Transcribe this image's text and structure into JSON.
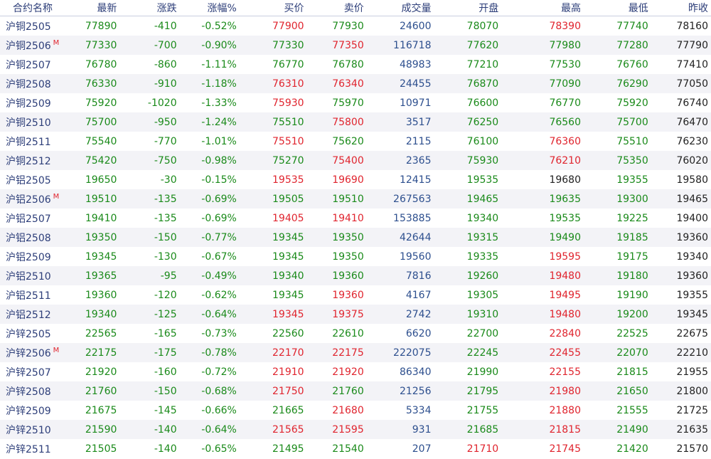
{
  "columns": [
    "合约名称",
    "最新",
    "涨跌",
    "涨幅%",
    "买价",
    "卖价",
    "成交量",
    "开盘",
    "最高",
    "最低",
    "昨收"
  ],
  "colors": {
    "green": "#1a8a1a",
    "red": "#e0242e",
    "black": "#222222",
    "blue": "#2d4f8e",
    "header": "#2d3e79",
    "stripe": "#f3f3f7"
  },
  "rows": [
    {
      "name": "沪铜2505",
      "badge": "",
      "last": "77890",
      "chg": "-410",
      "pct": "-0.52%",
      "bid": "77900",
      "ask": "77930",
      "vol": "24600",
      "open": "78070",
      "high": "78390",
      "low": "77740",
      "prev": "78160",
      "bid_c": "red",
      "ask_c": "green",
      "open_c": "green",
      "high_c": "red"
    },
    {
      "name": "沪铜2506",
      "badge": "M",
      "last": "77330",
      "chg": "-700",
      "pct": "-0.90%",
      "bid": "77330",
      "ask": "77350",
      "vol": "116718",
      "open": "77620",
      "high": "77980",
      "low": "77280",
      "prev": "77790",
      "bid_c": "green",
      "ask_c": "red",
      "open_c": "green",
      "high_c": "green"
    },
    {
      "name": "沪铜2507",
      "badge": "",
      "last": "76780",
      "chg": "-860",
      "pct": "-1.11%",
      "bid": "76770",
      "ask": "76780",
      "vol": "48983",
      "open": "77210",
      "high": "77530",
      "low": "76760",
      "prev": "77410",
      "bid_c": "green",
      "ask_c": "green",
      "open_c": "green",
      "high_c": "green"
    },
    {
      "name": "沪铜2508",
      "badge": "",
      "last": "76330",
      "chg": "-910",
      "pct": "-1.18%",
      "bid": "76310",
      "ask": "76340",
      "vol": "24455",
      "open": "76870",
      "high": "77090",
      "low": "76290",
      "prev": "77050",
      "bid_c": "red",
      "ask_c": "red",
      "open_c": "green",
      "high_c": "green"
    },
    {
      "name": "沪铜2509",
      "badge": "",
      "last": "75920",
      "chg": "-1020",
      "pct": "-1.33%",
      "bid": "75930",
      "ask": "75970",
      "vol": "10971",
      "open": "76600",
      "high": "76770",
      "low": "75920",
      "prev": "76740",
      "bid_c": "red",
      "ask_c": "green",
      "open_c": "green",
      "high_c": "green"
    },
    {
      "name": "沪铜2510",
      "badge": "",
      "last": "75700",
      "chg": "-950",
      "pct": "-1.24%",
      "bid": "75510",
      "ask": "75800",
      "vol": "3517",
      "open": "76250",
      "high": "76560",
      "low": "75700",
      "prev": "76470",
      "bid_c": "green",
      "ask_c": "red",
      "open_c": "green",
      "high_c": "green"
    },
    {
      "name": "沪铜2511",
      "badge": "",
      "last": "75540",
      "chg": "-770",
      "pct": "-1.01%",
      "bid": "75510",
      "ask": "75620",
      "vol": "2115",
      "open": "76100",
      "high": "76360",
      "low": "75510",
      "prev": "76230",
      "bid_c": "red",
      "ask_c": "green",
      "open_c": "green",
      "high_c": "red"
    },
    {
      "name": "沪铜2512",
      "badge": "",
      "last": "75420",
      "chg": "-750",
      "pct": "-0.98%",
      "bid": "75270",
      "ask": "75400",
      "vol": "2365",
      "open": "75930",
      "high": "76210",
      "low": "75350",
      "prev": "76020",
      "bid_c": "green",
      "ask_c": "red",
      "open_c": "green",
      "high_c": "red"
    },
    {
      "name": "沪铝2505",
      "badge": "",
      "last": "19650",
      "chg": "-30",
      "pct": "-0.15%",
      "bid": "19535",
      "ask": "19690",
      "vol": "12415",
      "open": "19535",
      "high": "19680",
      "low": "19355",
      "prev": "19580",
      "bid_c": "red",
      "ask_c": "red",
      "open_c": "green",
      "high_c": "black"
    },
    {
      "name": "沪铝2506",
      "badge": "M",
      "last": "19510",
      "chg": "-135",
      "pct": "-0.69%",
      "bid": "19505",
      "ask": "19510",
      "vol": "267563",
      "open": "19465",
      "high": "19635",
      "low": "19300",
      "prev": "19465",
      "bid_c": "green",
      "ask_c": "green",
      "open_c": "green",
      "high_c": "green"
    },
    {
      "name": "沪铝2507",
      "badge": "",
      "last": "19410",
      "chg": "-135",
      "pct": "-0.69%",
      "bid": "19405",
      "ask": "19410",
      "vol": "153885",
      "open": "19340",
      "high": "19535",
      "low": "19225",
      "prev": "19400",
      "bid_c": "red",
      "ask_c": "red",
      "open_c": "green",
      "high_c": "green"
    },
    {
      "name": "沪铝2508",
      "badge": "",
      "last": "19350",
      "chg": "-150",
      "pct": "-0.77%",
      "bid": "19345",
      "ask": "19350",
      "vol": "42644",
      "open": "19315",
      "high": "19490",
      "low": "19185",
      "prev": "19360",
      "bid_c": "green",
      "ask_c": "green",
      "open_c": "green",
      "high_c": "green"
    },
    {
      "name": "沪铝2509",
      "badge": "",
      "last": "19345",
      "chg": "-130",
      "pct": "-0.67%",
      "bid": "19345",
      "ask": "19350",
      "vol": "19560",
      "open": "19335",
      "high": "19595",
      "low": "19175",
      "prev": "19340",
      "bid_c": "green",
      "ask_c": "green",
      "open_c": "green",
      "high_c": "red"
    },
    {
      "name": "沪铝2510",
      "badge": "",
      "last": "19365",
      "chg": "-95",
      "pct": "-0.49%",
      "bid": "19340",
      "ask": "19360",
      "vol": "7816",
      "open": "19260",
      "high": "19480",
      "low": "19180",
      "prev": "19360",
      "bid_c": "green",
      "ask_c": "green",
      "open_c": "green",
      "high_c": "red"
    },
    {
      "name": "沪铝2511",
      "badge": "",
      "last": "19360",
      "chg": "-120",
      "pct": "-0.62%",
      "bid": "19345",
      "ask": "19360",
      "vol": "4167",
      "open": "19305",
      "high": "19495",
      "low": "19190",
      "prev": "19355",
      "bid_c": "green",
      "ask_c": "red",
      "open_c": "green",
      "high_c": "red"
    },
    {
      "name": "沪铝2512",
      "badge": "",
      "last": "19340",
      "chg": "-125",
      "pct": "-0.64%",
      "bid": "19345",
      "ask": "19375",
      "vol": "2742",
      "open": "19310",
      "high": "19480",
      "low": "19200",
      "prev": "19345",
      "bid_c": "red",
      "ask_c": "red",
      "open_c": "green",
      "high_c": "red"
    },
    {
      "name": "沪锌2505",
      "badge": "",
      "last": "22565",
      "chg": "-165",
      "pct": "-0.73%",
      "bid": "22560",
      "ask": "22610",
      "vol": "6620",
      "open": "22700",
      "high": "22840",
      "low": "22525",
      "prev": "22675",
      "bid_c": "green",
      "ask_c": "green",
      "open_c": "green",
      "high_c": "red"
    },
    {
      "name": "沪锌2506",
      "badge": "M",
      "last": "22175",
      "chg": "-175",
      "pct": "-0.78%",
      "bid": "22170",
      "ask": "22175",
      "vol": "222075",
      "open": "22245",
      "high": "22455",
      "low": "22070",
      "prev": "22210",
      "bid_c": "red",
      "ask_c": "red",
      "open_c": "green",
      "high_c": "red"
    },
    {
      "name": "沪锌2507",
      "badge": "",
      "last": "21920",
      "chg": "-160",
      "pct": "-0.72%",
      "bid": "21910",
      "ask": "21920",
      "vol": "86340",
      "open": "21990",
      "high": "22155",
      "low": "21815",
      "prev": "21955",
      "bid_c": "red",
      "ask_c": "red",
      "open_c": "green",
      "high_c": "red"
    },
    {
      "name": "沪锌2508",
      "badge": "",
      "last": "21760",
      "chg": "-150",
      "pct": "-0.68%",
      "bid": "21750",
      "ask": "21760",
      "vol": "21256",
      "open": "21795",
      "high": "21980",
      "low": "21650",
      "prev": "21800",
      "bid_c": "red",
      "ask_c": "green",
      "open_c": "green",
      "high_c": "red"
    },
    {
      "name": "沪锌2509",
      "badge": "",
      "last": "21675",
      "chg": "-145",
      "pct": "-0.66%",
      "bid": "21665",
      "ask": "21680",
      "vol": "5334",
      "open": "21755",
      "high": "21880",
      "low": "21555",
      "prev": "21725",
      "bid_c": "green",
      "ask_c": "red",
      "open_c": "green",
      "high_c": "red"
    },
    {
      "name": "沪锌2510",
      "badge": "",
      "last": "21590",
      "chg": "-140",
      "pct": "-0.64%",
      "bid": "21565",
      "ask": "21595",
      "vol": "931",
      "open": "21685",
      "high": "21815",
      "low": "21490",
      "prev": "21635",
      "bid_c": "red",
      "ask_c": "red",
      "open_c": "green",
      "high_c": "red"
    },
    {
      "name": "沪锌2511",
      "badge": "",
      "last": "21505",
      "chg": "-140",
      "pct": "-0.65%",
      "bid": "21495",
      "ask": "21540",
      "vol": "207",
      "open": "21710",
      "high": "21745",
      "low": "21420",
      "prev": "21570",
      "bid_c": "green",
      "ask_c": "green",
      "open_c": "red",
      "high_c": "red"
    }
  ]
}
